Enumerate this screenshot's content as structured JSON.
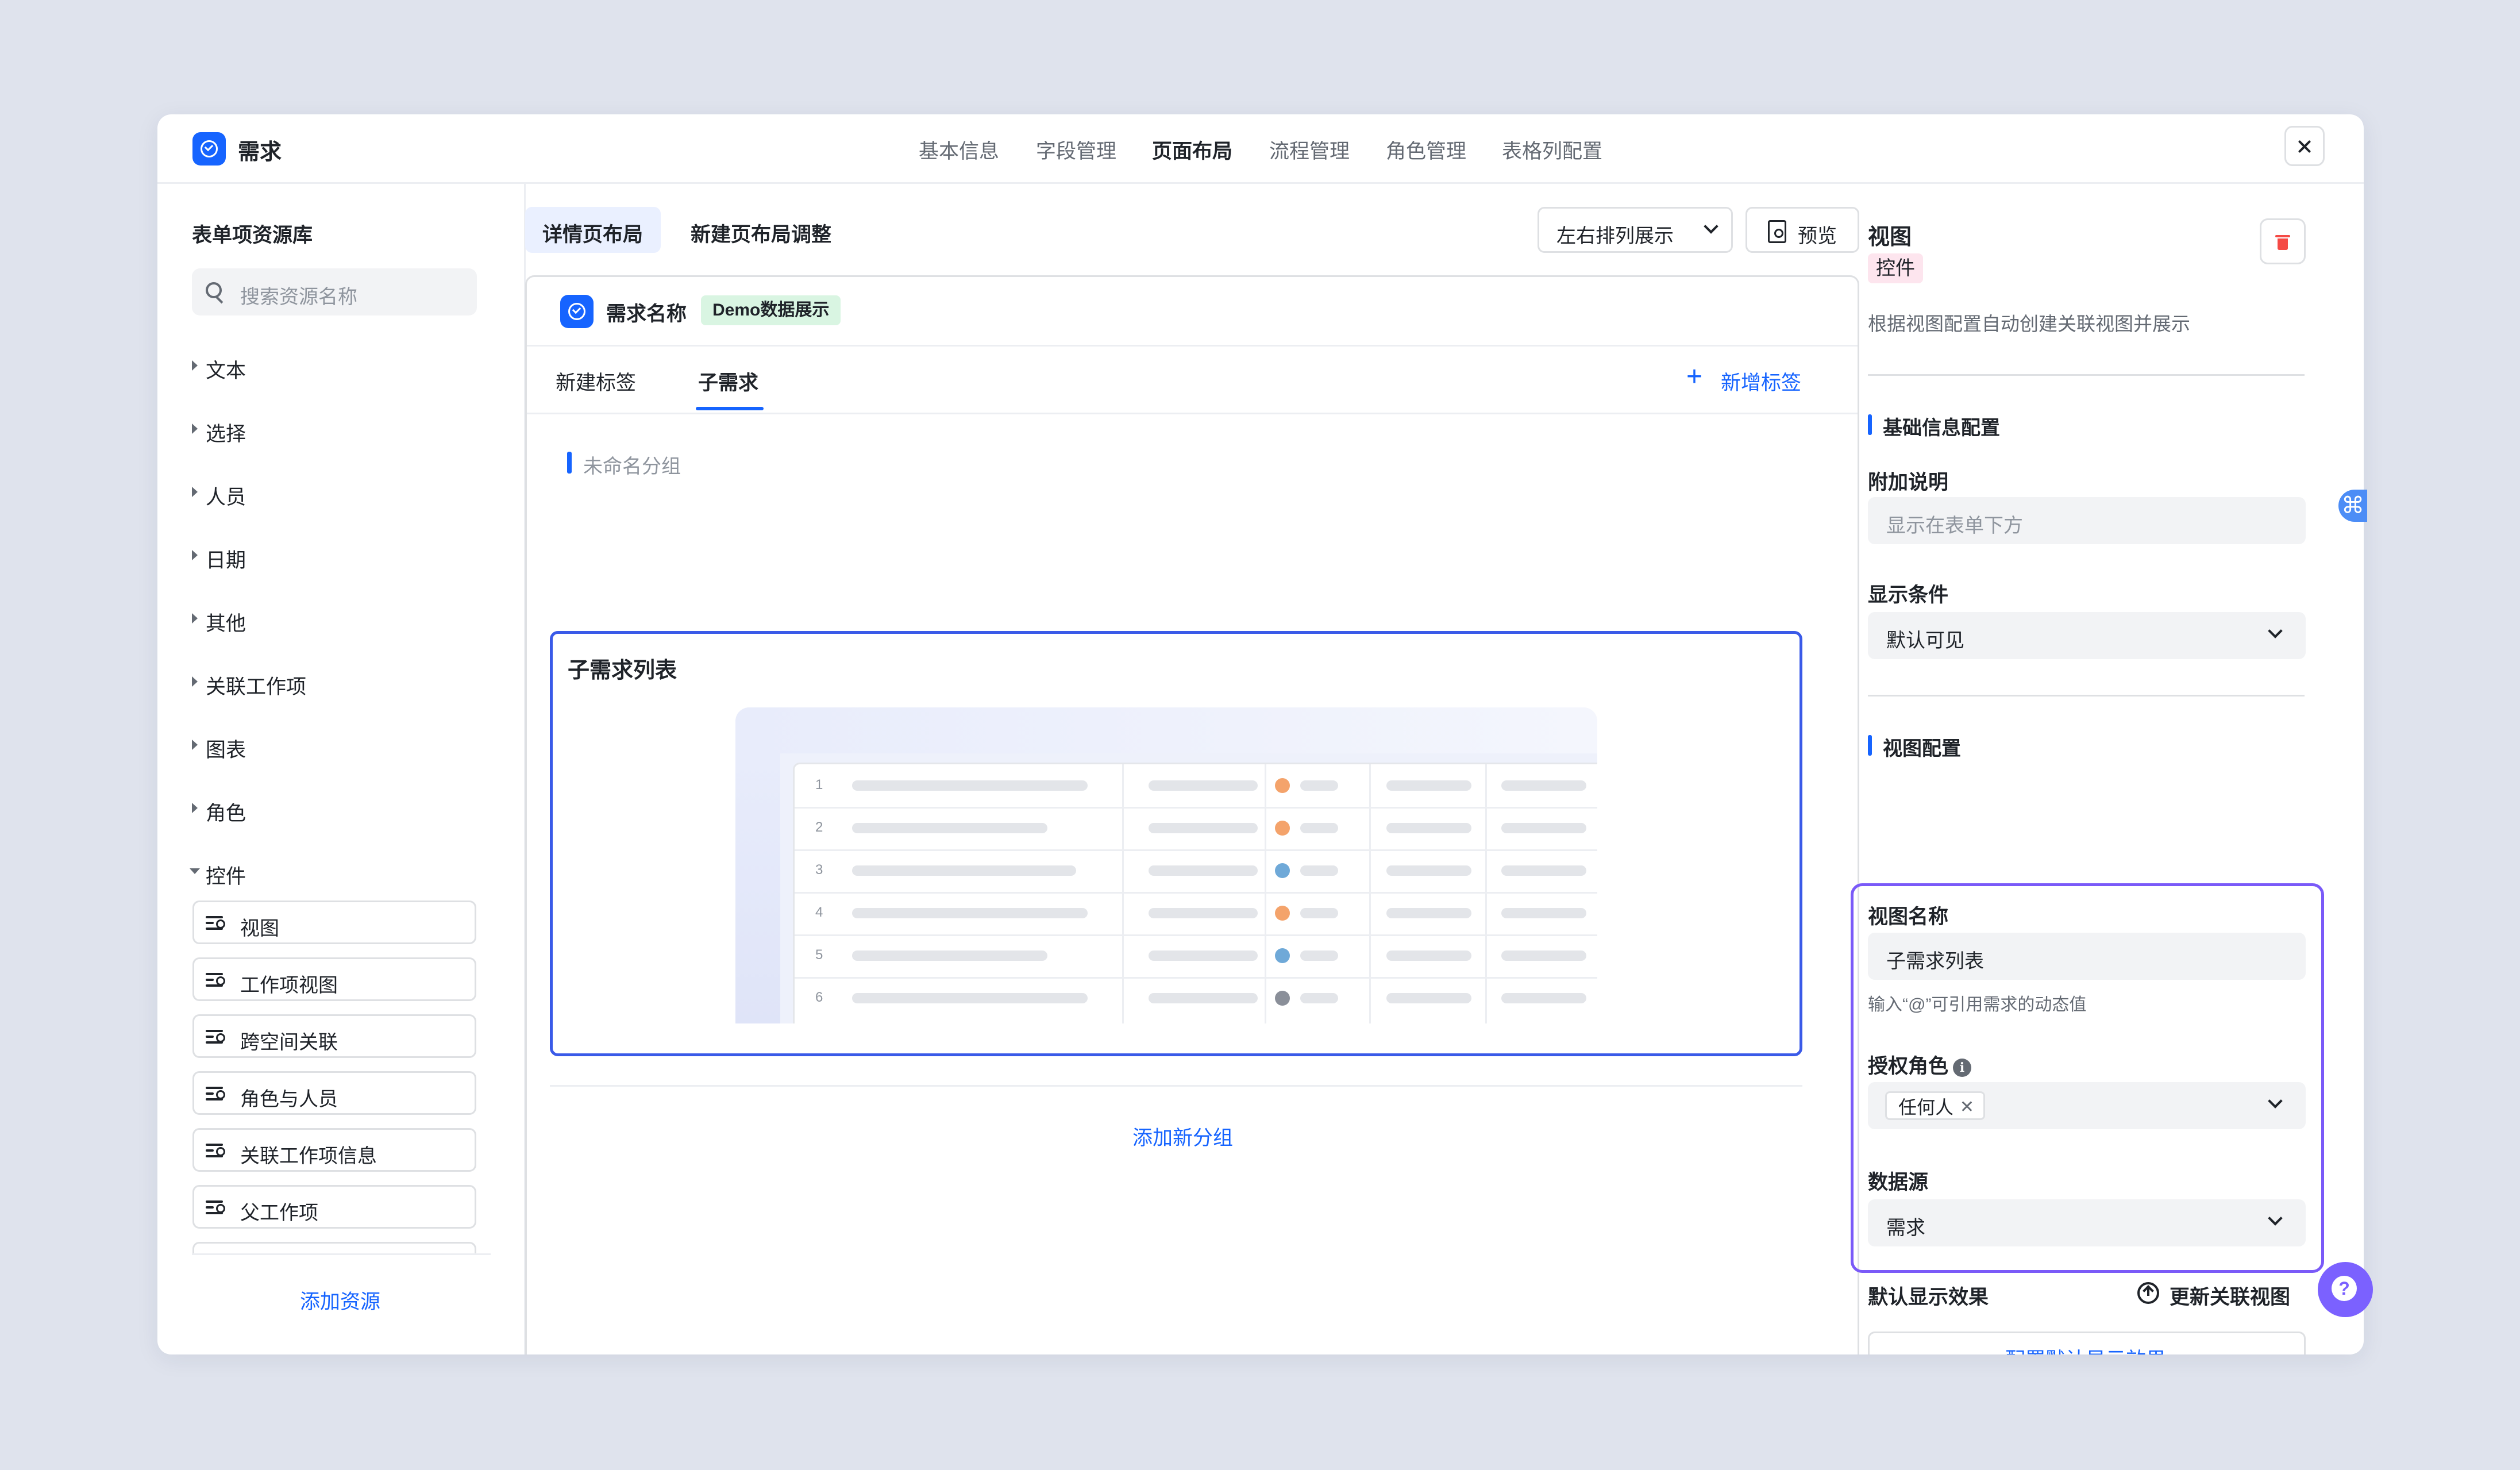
{
  "header": {
    "title": "需求",
    "nav": [
      "基本信息",
      "字段管理",
      "页面布局",
      "流程管理",
      "角色管理",
      "表格列配置"
    ],
    "active_nav": "页面布局"
  },
  "left": {
    "title": "表单项资源库",
    "search_placeholder": "搜索资源名称",
    "categories": [
      "文本",
      "选择",
      "人员",
      "日期",
      "其他",
      "关联工作项",
      "图表",
      "角色",
      "控件"
    ],
    "controls": [
      "视图",
      "工作项视图",
      "跨空间关联",
      "角色与人员",
      "关联工作项信息",
      "父工作项"
    ],
    "add_resource": "添加资源"
  },
  "middle": {
    "tabs": [
      "详情页布局",
      "新建页布局调整"
    ],
    "layout_select": "左右排列展示",
    "preview_btn": "预览",
    "record_title": "需求名称",
    "demo_badge": "Demo数据展示",
    "sub_tabs": [
      "新建标签",
      "子需求"
    ],
    "add_tab": "新增标签",
    "group_name": "未命名分组",
    "view_title": "子需求列表",
    "table_rows": [
      "1",
      "2",
      "3",
      "4",
      "5",
      "6"
    ],
    "add_group": "添加新分组"
  },
  "right": {
    "title": "视图",
    "type_badge": "控件",
    "description": "根据视图配置自动创建关联视图并展示",
    "basic_section": "基础信息配置",
    "extra_label": "附加说明",
    "extra_placeholder": "显示在表单下方",
    "cond_label": "显示条件",
    "cond_value": "默认可见",
    "view_section": "视图配置",
    "view_name_label": "视图名称",
    "view_name_value": "子需求列表",
    "view_name_hint": "输入“@”可引用需求的动态值",
    "role_label": "授权角色",
    "role_tag": "任何人",
    "source_label": "数据源",
    "source_value": "需求",
    "default_label": "默认显示效果",
    "refresh_label": "更新关联视图",
    "config_btn": "配置默认显示效果"
  },
  "colors": {
    "accent": "#1664ff",
    "focus": "#3a5ae8",
    "panel_focus": "#7a5af8",
    "danger": "#f54a45"
  }
}
